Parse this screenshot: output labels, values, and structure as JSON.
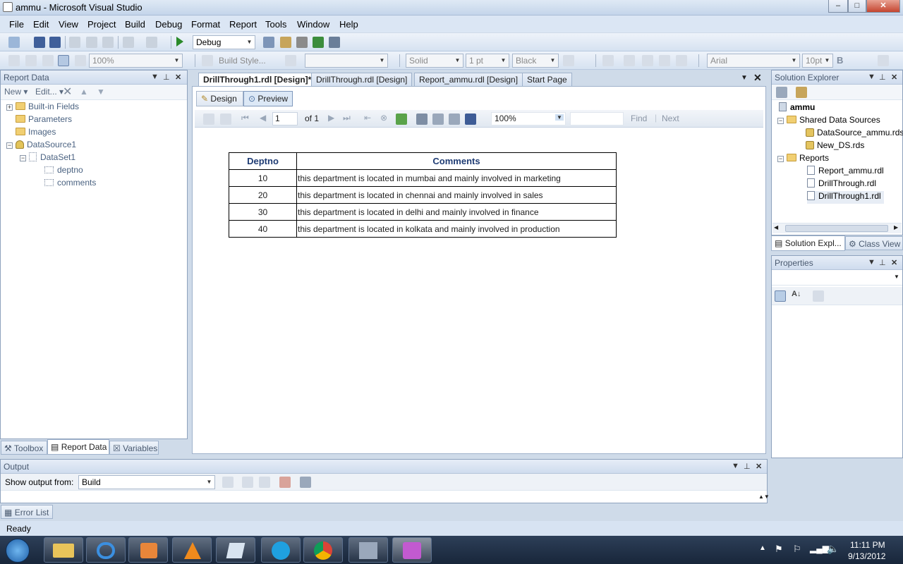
{
  "window": {
    "title": "ammu - Microsoft Visual Studio",
    "minimize": "–",
    "maximize": "□",
    "close": "✕"
  },
  "menu": [
    "File",
    "Edit",
    "View",
    "Project",
    "Build",
    "Debug",
    "Format",
    "Report",
    "Tools",
    "Window",
    "Help"
  ],
  "toolbar1": {
    "config": "Debug"
  },
  "toolbar2": {
    "zoom": "100%",
    "build_style": "Build Style...",
    "border_style": "Solid",
    "border_width": "1 pt",
    "border_color": "Black",
    "font": "Arial",
    "font_size": "10pt",
    "bold": "B"
  },
  "report_data": {
    "title": "Report Data",
    "new": "New",
    "edit": "Edit...",
    "items": [
      "Built-in Fields",
      "Parameters",
      "Images",
      "DataSource1",
      "DataSet1",
      "deptno",
      "comments"
    ]
  },
  "left_tabs": [
    "Toolbox",
    "Report Data",
    "Variables"
  ],
  "doc_tabs": [
    "DrillThrough1.rdl [Design]*",
    "DrillThrough.rdl [Design]",
    "Report_ammu.rdl [Design]",
    "Start Page"
  ],
  "view_tabs": [
    "Design",
    "Preview"
  ],
  "preview_toolbar": {
    "page": "1",
    "of": "of 1",
    "zoom": "100%",
    "find": "Find",
    "next": "Next"
  },
  "report": {
    "headers": [
      "Deptno",
      "Comments"
    ],
    "rows": [
      [
        "10",
        "this department is located in mumbai and mainly involved in marketing"
      ],
      [
        "20",
        "this department is located in chennai and mainly involved in sales"
      ],
      [
        "30",
        "this department is located in delhi and mainly involved in finance"
      ],
      [
        "40",
        "this department is located in kolkata and mainly involved in production"
      ]
    ]
  },
  "solution_explorer": {
    "title": "Solution Explorer",
    "project": "ammu",
    "shared_folder": "Shared Data Sources",
    "shared_items": [
      "DataSource_ammu.rds",
      "New_DS.rds"
    ],
    "reports_folder": "Reports",
    "report_items": [
      "Report_ammu.rdl",
      "DrillThrough.rdl",
      "DrillThrough1.rdl"
    ]
  },
  "right_tabs": [
    "Solution Expl...",
    "Class View"
  ],
  "properties": {
    "title": "Properties"
  },
  "output": {
    "title": "Output",
    "show_from_label": "Show output from:",
    "show_from_value": "Build"
  },
  "error_list": "Error List",
  "status": "Ready",
  "clock": {
    "time": "11:11 PM",
    "date": "9/13/2012"
  },
  "colors": {
    "accent": "#1f3c74",
    "chrome": "#cfdbe9"
  }
}
